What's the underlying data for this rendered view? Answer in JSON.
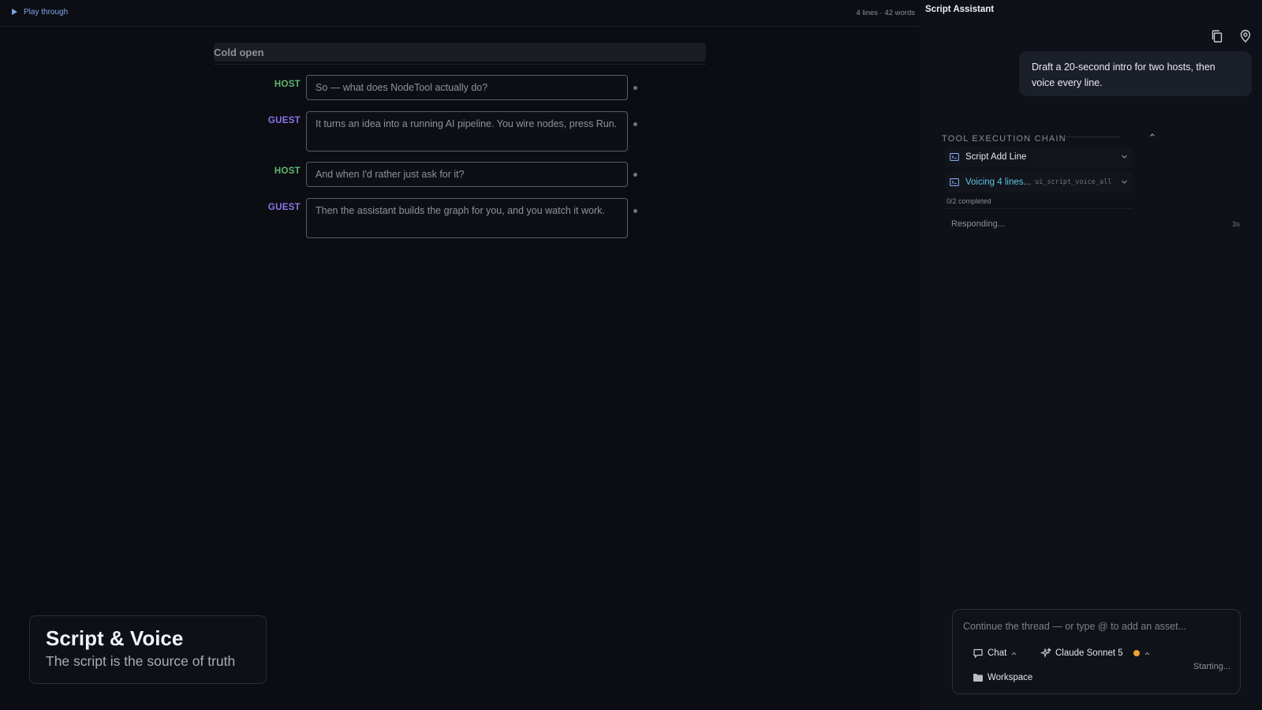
{
  "topbar": {
    "play_label": "Play through",
    "stats": "4 lines · 42 words"
  },
  "script": {
    "section_title": "Cold open",
    "lines": [
      {
        "speaker": "HOST",
        "text": "So — what does NodeTool actually do?"
      },
      {
        "speaker": "GUEST",
        "text": "It turns an idea into a running AI pipeline. You wire nodes, press Run."
      },
      {
        "speaker": "HOST",
        "text": "And when I'd rather just ask for it?"
      },
      {
        "speaker": "GUEST",
        "text": "Then the assistant builds the graph for you, and you watch it work."
      }
    ]
  },
  "badge": {
    "title": "Script & Voice",
    "subtitle": "The script is the source of truth"
  },
  "assistant": {
    "title": "Script Assistant",
    "user_message": "Draft a 20-second intro for two hosts, then voice every line.",
    "chain_label": "TOOL EXECUTION CHAIN",
    "tools": [
      {
        "name": "Script Add Line",
        "code": "",
        "status": "done"
      },
      {
        "name": "Voicing 4 lines...",
        "code": "ui_script_voice_all",
        "status": "running"
      }
    ],
    "progress": "0/2 completed",
    "responding": "Responding...",
    "responding_time": "3s",
    "composer": {
      "placeholder": "Continue the thread — or type @ to add an asset...",
      "mode_label": "Chat",
      "model_label": "Claude Sonnet 5",
      "workspace_label": "Workspace",
      "status": "Starting..."
    }
  },
  "colors": {
    "host": "#5fb86f",
    "guest": "#8a76e6",
    "running": "#5fc5e6",
    "status_dot": "#f0a030"
  }
}
